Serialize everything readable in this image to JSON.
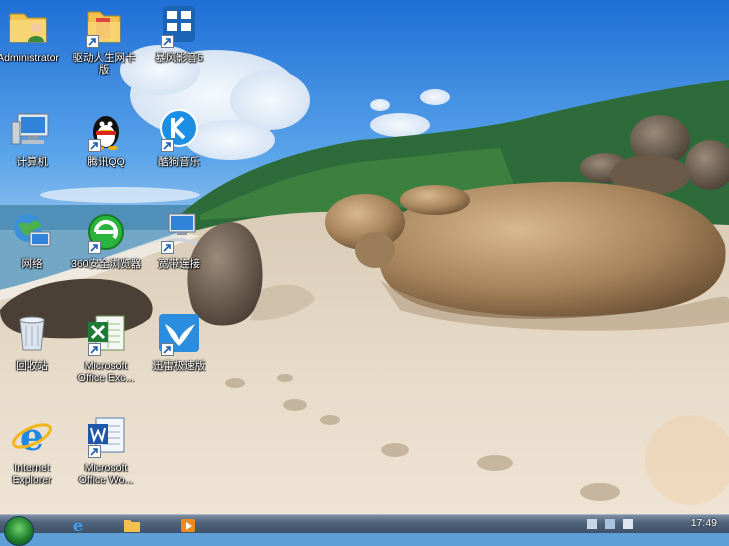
{
  "desktop": {
    "icons": [
      {
        "id": "administrator",
        "label": "Administrator",
        "icon": "user-folder-icon"
      },
      {
        "id": "driver-wizard",
        "label": "驱动人生网卡版",
        "icon": "folder-icon"
      },
      {
        "id": "baofeng",
        "label": "暴风影音5",
        "icon": "video-player-icon"
      },
      {
        "id": "computer",
        "label": "计算机",
        "icon": "computer-icon"
      },
      {
        "id": "qq",
        "label": "腾讯QQ",
        "icon": "qq-penguin-icon"
      },
      {
        "id": "kugou",
        "label": "酷狗音乐",
        "icon": "kugou-icon"
      },
      {
        "id": "network",
        "label": "网络",
        "icon": "network-globe-icon"
      },
      {
        "id": "360-browser",
        "label": "360安全浏览器",
        "icon": "360-browser-icon"
      },
      {
        "id": "broadband",
        "label": "宽带连接",
        "icon": "broadband-connection-icon"
      },
      {
        "id": "recycle-bin",
        "label": "回收站",
        "icon": "recycle-bin-icon"
      },
      {
        "id": "excel",
        "label": "Microsoft Office Exc...",
        "icon": "excel-icon"
      },
      {
        "id": "xunlei",
        "label": "迅雷极速版",
        "icon": "xunlei-bird-icon"
      },
      {
        "id": "ie",
        "label": "Internet Explorer",
        "icon": "internet-explorer-icon"
      },
      {
        "id": "word",
        "label": "Microsoft Office Wo...",
        "icon": "word-icon"
      }
    ]
  },
  "taskbar": {
    "pinned": [
      "internet-explorer-icon",
      "explorer-folder-icon",
      "media-player-icon"
    ],
    "clock": "17:49"
  },
  "colors": {
    "taskbar": "#4a5e76",
    "sky": "#3f8fe0",
    "sand": "#e8dccb"
  }
}
